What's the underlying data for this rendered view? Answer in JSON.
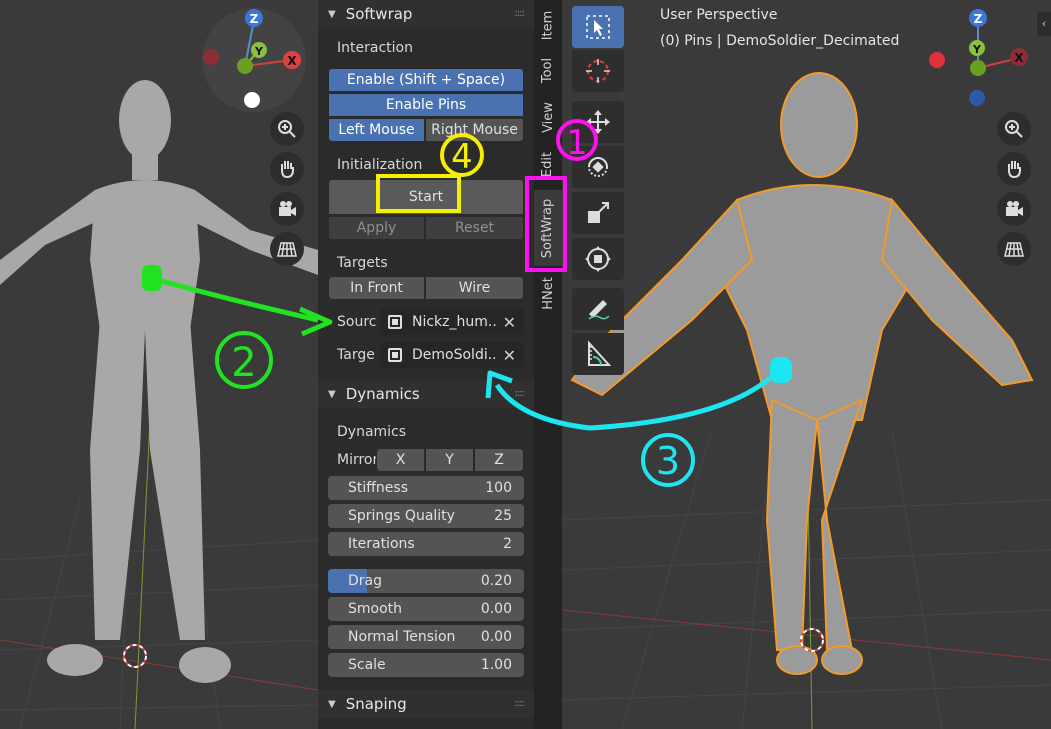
{
  "panel": {
    "softwrap_header": "Softwrap",
    "interaction_label": "Interaction",
    "enable_button": "Enable (Shift + Space)",
    "enable_pins_button": "Enable Pins",
    "left_mouse_button": "Left Mouse",
    "right_mouse_button": "Right Mouse",
    "initialization_label": "Initialization",
    "start_button": "Start",
    "apply_button": "Apply",
    "reset_button": "Reset",
    "targets_label": "Targets",
    "in_front_button": "In Front",
    "wire_button": "Wire",
    "source_label": "Sourc",
    "source_value": "Nickz_hum..",
    "target_label": "Targe",
    "target_value": "DemoSoldi..",
    "dynamics_header": "Dynamics",
    "dynamics_label": "Dynamics",
    "mirror_label": "Mirror",
    "mirror_x": "X",
    "mirror_y": "Y",
    "mirror_z": "Z",
    "fields": [
      {
        "label": "Stiffness",
        "value": "100"
      },
      {
        "label": "Springs Quality",
        "value": "25"
      },
      {
        "label": "Iterations",
        "value": "2"
      },
      {
        "label": "Drag",
        "value": "0.20"
      },
      {
        "label": "Smooth",
        "value": "0.00"
      },
      {
        "label": "Normal Tension",
        "value": "0.00"
      },
      {
        "label": "Scale",
        "value": "1.00"
      }
    ],
    "snaping_header": "Snaping"
  },
  "tabs": [
    "Item",
    "Tool",
    "View",
    "Edit",
    "SoftWrap",
    "HNet"
  ],
  "viewport_right": {
    "title": "User Perspective",
    "subtitle": "(0) Pins | DemoSoldier_Decimated"
  },
  "gizmo": {
    "z": "Z",
    "y": "Y",
    "x": "X"
  },
  "annotations": {
    "one": "1",
    "two": "2",
    "three": "3",
    "four": "4"
  },
  "colors": {
    "accent": "#4a72b0",
    "annot_green": "#22e322",
    "annot_cyan": "#1ee6f0",
    "annot_magenta": "#ff10f0",
    "annot_yellow": "#f4f000"
  }
}
